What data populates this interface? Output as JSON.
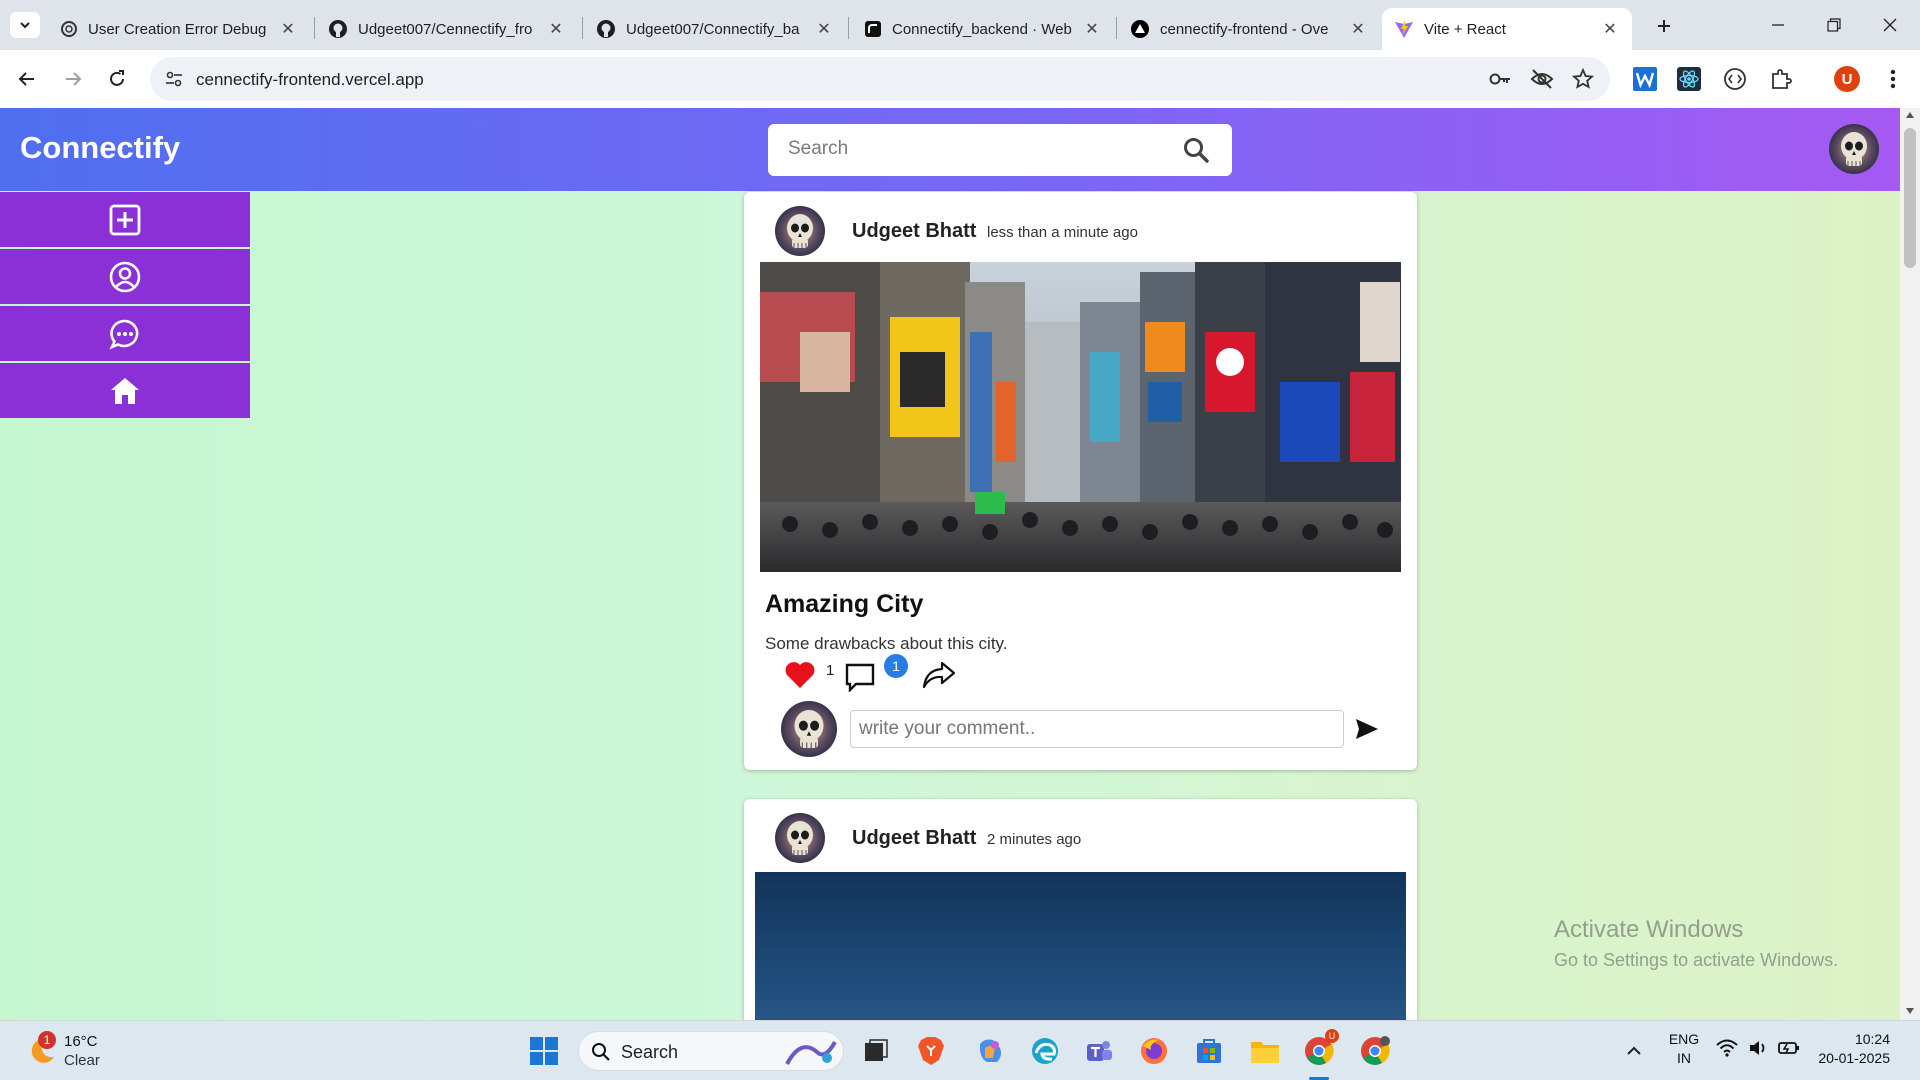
{
  "browser": {
    "tabs": [
      {
        "title": "User Creation Error Debug",
        "icon": "chatgpt-icon"
      },
      {
        "title": "Udgeet007/Cennectify_fro",
        "icon": "github-icon"
      },
      {
        "title": "Udgeet007/Connectify_ba",
        "icon": "github-icon"
      },
      {
        "title": "Connectify_backend · Web",
        "icon": "render-icon"
      },
      {
        "title": "cennectify-frontend - Ove",
        "icon": "vercel-icon"
      },
      {
        "title": "Vite + React",
        "icon": "vite-icon",
        "active": true
      }
    ],
    "url": "cennectify-frontend.vercel.app",
    "profile_initial": "U"
  },
  "app": {
    "brand": "Connectify",
    "search_placeholder": "Search",
    "sidebar": [
      {
        "name": "create-post",
        "icon": "plus-square-icon"
      },
      {
        "name": "profile",
        "icon": "user-circle-icon"
      },
      {
        "name": "messages",
        "icon": "chat-bubble-icon"
      },
      {
        "name": "home",
        "icon": "home-icon"
      }
    ],
    "posts": [
      {
        "author": "Udgeet Bhatt",
        "time": "less than a minute ago",
        "title": "Amazing City",
        "body": "Some drawbacks about this city.",
        "likes": "1",
        "comments": "1",
        "comment_placeholder": "write your comment.."
      },
      {
        "author": "Udgeet Bhatt",
        "time": "2 minutes ago"
      }
    ]
  },
  "watermark": {
    "line1": "Activate Windows",
    "line2": "Go to Settings to activate Windows."
  },
  "taskbar": {
    "weather_temp": "16°C",
    "weather_desc": "Clear",
    "weather_badge": "1",
    "search_label": "Search",
    "lang": "ENG",
    "region": "IN",
    "time": "10:24",
    "date": "20-01-2025"
  },
  "colors": {
    "navbar_start": "#4f6ff0",
    "navbar_end": "#a55af2",
    "sidebar": "#8b2fd6",
    "page_bg": "#c5f7cf",
    "like": "#e8101a",
    "badge": "#2a7be4"
  }
}
